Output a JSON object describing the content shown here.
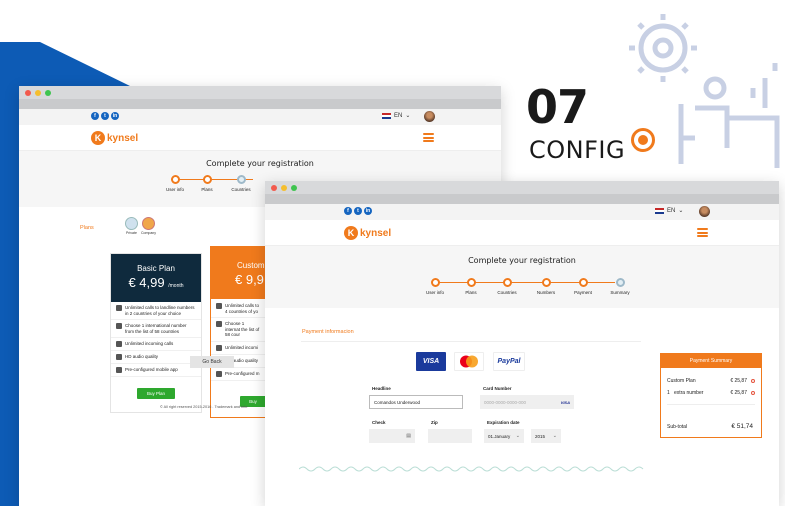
{
  "colors": {
    "accent": "#f07a1c",
    "blue": "#0d5bb5",
    "green": "#2ea82e"
  },
  "hero": {
    "number": "07",
    "word": "CONFIG"
  },
  "header": {
    "social": [
      "f",
      "t",
      "in"
    ],
    "lang": "EN",
    "logo_letter": "K",
    "logo_text": "kynsel"
  },
  "registration": {
    "title": "Complete your registration",
    "back_steps": [
      "User info",
      "Plans",
      "Countries"
    ],
    "steps": [
      "User info",
      "Plans",
      "Countries",
      "Numbers",
      "Payment",
      "Summary"
    ]
  },
  "plans": {
    "label": "Plans",
    "types": [
      "Private",
      "Company"
    ],
    "basic": {
      "name": "Basic Plan",
      "price": "€ 4,99",
      "per": "/month"
    },
    "custom": {
      "name": "Custom",
      "price": "€ 9,9"
    },
    "basic_features": [
      "Unlimited calls to landline numbers in 2 countries of your choice",
      "Choose 1 international number from the list of 58 countries",
      "Unlimited incoming calls",
      "HD audio quality",
      "Pre-configured mobile app"
    ],
    "custom_features": [
      "Unlimited calls to 4 countries of yo",
      "Choose 1 internat the list of 58 cour",
      "Unlimited incomi",
      "HD audio quality",
      "Pre-configured m"
    ],
    "buy": "Buy Plan",
    "buy_custom": "Buy",
    "go_back": "Go Back",
    "rights": "© All right reserved 2015-2016 . Trademark and Inte"
  },
  "payment": {
    "title": "Payment informacion",
    "card_brands": [
      "VISA",
      "MasterCard",
      "PayPal"
    ],
    "headline_label": "Headline",
    "headline_value": "Comandos Underwood",
    "card_number_label": "Card Number",
    "card_number_placeholder": "0000-0000-0000-000",
    "card_type": "VISA",
    "check_label": "Check",
    "zip_label": "Zip",
    "expiration_label": "Expiration date",
    "month": "01.January",
    "year": "2015"
  },
  "summary": {
    "title": "Payment Summary",
    "rows": [
      {
        "qty": "",
        "name": "Custom Plan",
        "price": "€ 25,87"
      },
      {
        "qty": "1",
        "name": "extra number",
        "price": "€ 25,87"
      }
    ],
    "subtotal_label": "Sub-total",
    "subtotal": "€ 51,74"
  }
}
